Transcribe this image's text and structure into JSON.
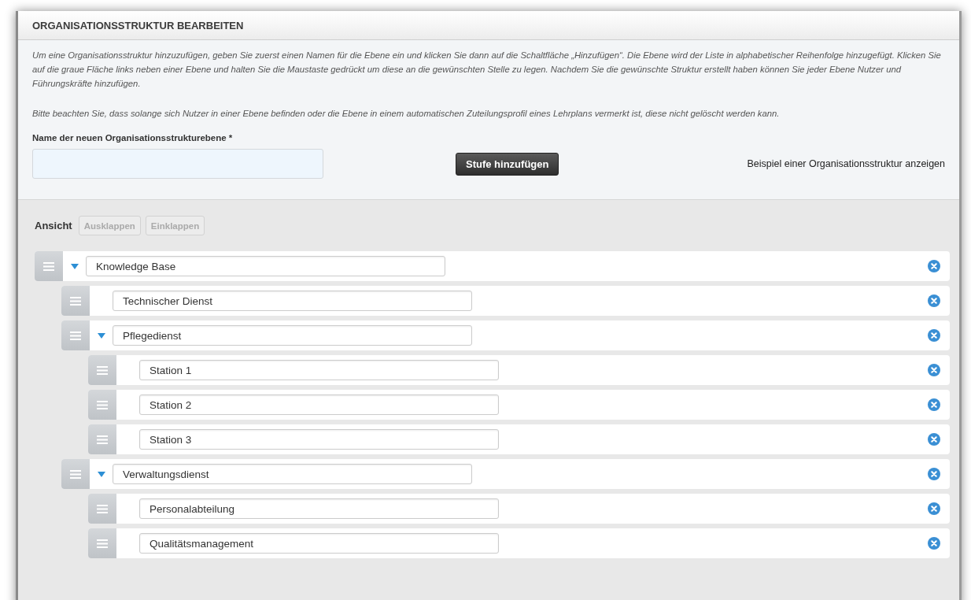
{
  "panel": {
    "title": "ORGANISATIONSSTRUKTUR BEARBEITEN",
    "intro": "Um eine Organisationsstruktur hinzuzufügen, geben Sie zuerst einen Namen für die Ebene ein und klicken Sie dann auf die Schaltfläche „Hinzufügen“. Die Ebene wird der Liste in alphabetischer Reihenfolge hinzugefügt. Klicken Sie auf die graue Fläche links neben einer Ebene und halten Sie die Maustaste gedrückt um diese an die gewünschten Stelle zu legen. Nachdem Sie die gewünschte Struktur erstellt haben können Sie jeder Ebene Nutzer und Führungskräfte hinzufügen.",
    "note": "Bitte beachten Sie, dass solange sich Nutzer in einer Ebene befinden oder die Ebene in einem automatischen Zuteilungsprofil eines Lehrplans vermerkt ist, diese nicht gelöscht werden kann.",
    "field_label": "Name der neuen Organisationsstrukturebene *",
    "add_button": "Stufe hinzufügen",
    "example_link": "Beispiel einer Organisationsstruktur anzeigen"
  },
  "view": {
    "label": "Ansicht",
    "buttons": [
      {
        "label": "Ausklappen",
        "disabled": true
      },
      {
        "label": "Einklappen",
        "disabled": true
      }
    ]
  },
  "tree": [
    {
      "name": "Knowledge Base",
      "expanded": true,
      "children": [
        {
          "name": "Technischer Dienst"
        },
        {
          "name": "Pflegedienst",
          "expanded": true,
          "children": [
            {
              "name": "Station 1"
            },
            {
              "name": "Station 2"
            },
            {
              "name": "Station 3"
            }
          ]
        },
        {
          "name": "Verwaltungsdienst",
          "expanded": true,
          "children": [
            {
              "name": "Personalabteilung"
            },
            {
              "name": "Qualitätsmanagement"
            }
          ]
        }
      ]
    }
  ]
}
